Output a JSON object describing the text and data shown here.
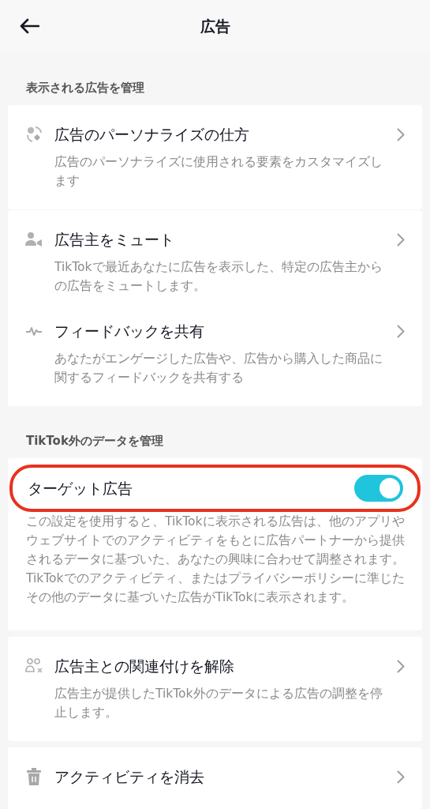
{
  "header": {
    "title": "広告"
  },
  "sections": [
    {
      "title": "表示される広告を管理",
      "cards": [
        {
          "rows": [
            {
              "kind": "link",
              "label": "広告のパーソナライズの仕方",
              "description": "広告のパーソナライズに使用される要素をカスタマイズします"
            }
          ]
        },
        {
          "rows": [
            {
              "kind": "link",
              "label": "広告主をミュート",
              "description": "TikTokで最近あなたに広告を表示した、特定の広告主からの広告をミュートします。"
            },
            {
              "kind": "link",
              "label": "フィードバックを共有",
              "description": "あなたがエンゲージした広告や、広告から購入した商品に関するフィードバックを共有する"
            }
          ]
        }
      ]
    },
    {
      "title": "TikTok外のデータを管理",
      "cards": [
        {
          "rows": [
            {
              "kind": "toggle",
              "label": "ターゲット広告",
              "on": true,
              "highlighted": true,
              "description": [
                "この設定を使用すると、TikTokに表示される広告は、他のアプリやウェブサイトでのアクティビティをもとに広告パートナーから提供されるデータに基づいた、あなたの興味に合わせて調整されます。",
                "TikTokでのアクティビティ、またはプライバシーポリシーに準じたその他のデータに基づいた広告がTikTokに表示されます。"
              ]
            }
          ]
        },
        {
          "rows": [
            {
              "kind": "link",
              "label": "広告主との関連付けを解除",
              "description": "広告主が提供したTikTok外のデータによる広告の調整を停止します。"
            }
          ]
        },
        {
          "rows": [
            {
              "kind": "link",
              "label": "アクティビティを消去"
            }
          ]
        }
      ]
    }
  ]
}
